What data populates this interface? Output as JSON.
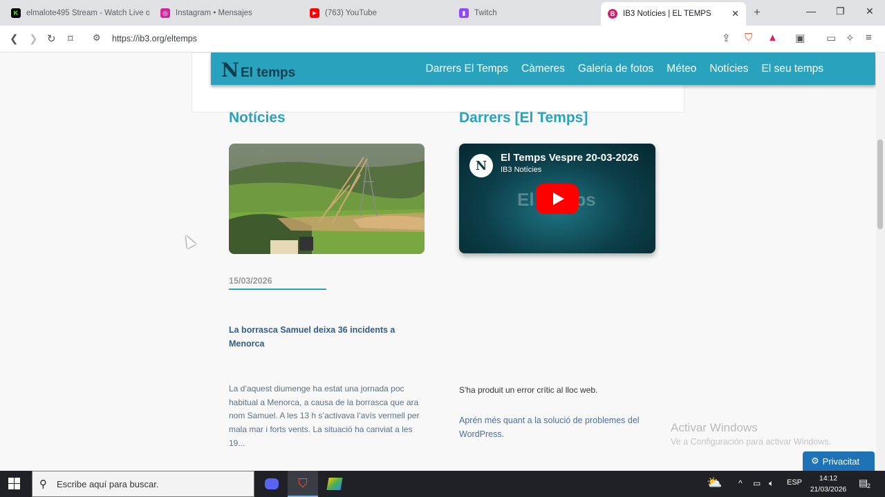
{
  "browser": {
    "tabs": [
      {
        "title": "elmalote495 Stream - Watch Live o",
        "favicon_color": "#53fc18",
        "favicon_glyph": "K"
      },
      {
        "title": "Instagram • Mensajes",
        "favicon_color": "#d6249f",
        "favicon_glyph": "◎"
      },
      {
        "title": "(763) YouTube",
        "favicon_color": "#ff0000",
        "favicon_glyph": "▶"
      },
      {
        "title": "Twitch",
        "favicon_color": "#9146ff",
        "favicon_glyph": "▮"
      },
      {
        "title": "IB3 Notícies | EL TEMPS",
        "favicon_color": "#d61f69",
        "favicon_glyph": "B"
      }
    ],
    "url": "https://ib3.org/eltemps"
  },
  "site": {
    "logo_letter": "N",
    "logo_text": "El temps",
    "nav": [
      "Darrers El Temps",
      "Càmeres",
      "Galeria de fotos",
      "Méteo",
      "Notícies",
      "El seu temps"
    ],
    "accent_color": "#29a2bd"
  },
  "news": {
    "section_title": "Notícies",
    "date": "15/03/2026",
    "headline": "La borrasca Samuel deixa 36 incidents a Menorca",
    "excerpt": "La d’aquest diumenge ha estat una jornada poc habitual a Menorca, a causa de la borrasca que ara nom Samuel. A les 13 h s’activava l’avís vermell per mala mar i forts vents. La situació ha canviat a les 19..."
  },
  "latest": {
    "section_title": "Darrers [El Temps]",
    "video_title": "El Temps Vespre 20-03-2026",
    "video_channel": "IB3 Notícies",
    "video_bg_text": "El Temps",
    "error": "S'ha produit un error crític al lloc web.",
    "learn_more": "Aprén més quant a la solució de problemes del WordPress."
  },
  "watermark": {
    "line1": "Activar Windows",
    "line2": "Ve a Configuración para activar Windows."
  },
  "privacy_label": "Privacitat",
  "taskbar": {
    "search_placeholder": "Escribe aquí para buscar.",
    "lang": "ESP",
    "time": "14:12",
    "date": "21/03/2026",
    "notifications": "2"
  }
}
